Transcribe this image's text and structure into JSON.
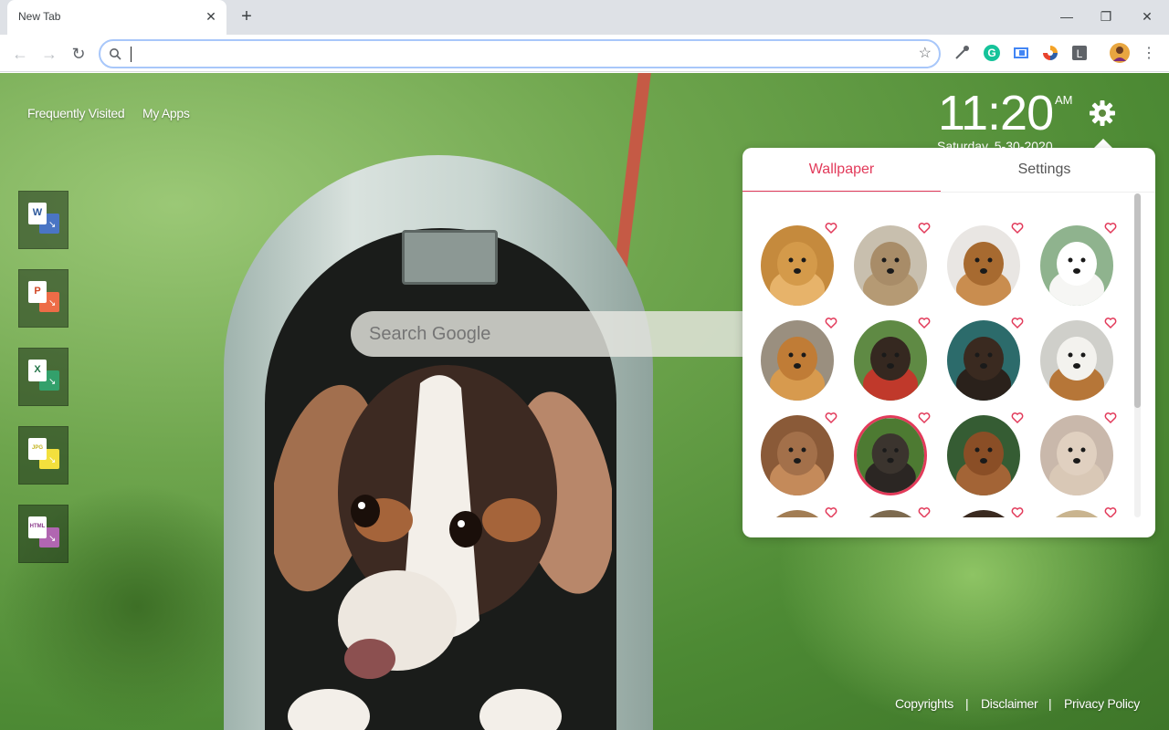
{
  "browser": {
    "tab_title": "New Tab",
    "tab_close": "✕",
    "new_tab": "+",
    "window_minimize": "—",
    "window_maximize": "❐",
    "window_close": "✕",
    "omnibox_value": "",
    "extensions": [
      "eyedropper-extension",
      "grammarly-extension",
      "tab-extension",
      "sync-extension",
      "l-extension",
      "profile-avatar"
    ]
  },
  "nav": {
    "frequently_visited": "Frequently Visited",
    "my_apps": "My Apps"
  },
  "apps": [
    {
      "name": "word",
      "letter": "W",
      "front": "#2b579a",
      "back": "#4a75c4"
    },
    {
      "name": "powerpoint",
      "letter": "P",
      "front": "#d24726",
      "back": "#ed6c47"
    },
    {
      "name": "excel",
      "letter": "X",
      "front": "#217346",
      "back": "#33a06b"
    },
    {
      "name": "jpg",
      "letter": "JPG",
      "front": "#c3b31e",
      "back": "#f3e03d"
    },
    {
      "name": "html",
      "letter": "HTML",
      "front": "#8c3c8c",
      "back": "#b166b1"
    }
  ],
  "search": {
    "placeholder": "Search Google"
  },
  "clock": {
    "time": "11:20",
    "ampm": "AM",
    "date": "Saturday, 5-30-2020"
  },
  "panel": {
    "tab_wallpaper": "Wallpaper",
    "tab_settings": "Settings",
    "selected_index": 9,
    "thumbs": [
      {
        "bg": "#c58a3d",
        "fg": "#e7b36a",
        "dog": "#d49a4a"
      },
      {
        "bg": "#c8bfae",
        "fg": "#b59a74",
        "dog": "#a88c68"
      },
      {
        "bg": "#e9e6e3",
        "fg": "#c98d4f",
        "dog": "#a76a30"
      },
      {
        "bg": "#8fb38e",
        "fg": "#f6f6f4",
        "dog": "#ffffff"
      },
      {
        "bg": "#9a8f7f",
        "fg": "#d79a4e",
        "dog": "#c07c36"
      },
      {
        "bg": "#5f8a44",
        "fg": "#c0392b",
        "dog": "#352820"
      },
      {
        "bg": "#2c6b6b",
        "fg": "#2a211b",
        "dog": "#3a2a20"
      },
      {
        "bg": "#cfcfca",
        "fg": "#b67638",
        "dog": "#f3f2ee"
      },
      {
        "bg": "#8a5a38",
        "fg": "#c48a5a",
        "dog": "#a3704a"
      },
      {
        "bg": "#4d7a32",
        "fg": "#2b2623",
        "dog": "#3b342e"
      },
      {
        "bg": "#355c33",
        "fg": "#a36436",
        "dog": "#8a4e26"
      },
      {
        "bg": "#c9b8ab",
        "fg": "#d9c8b6",
        "dog": "#e0d0c0"
      },
      {
        "bg": "#a27d54",
        "fg": "#c9a172",
        "dog": "#b08a60"
      },
      {
        "bg": "#7d6a4f",
        "fg": "#c9a26c",
        "dog": "#b68e58"
      },
      {
        "bg": "#3a2a20",
        "fg": "#7a4a2a",
        "dog": "#5a3520"
      },
      {
        "bg": "#c9b48f",
        "fg": "#e6d2b0",
        "dog": "#dcc49e"
      }
    ]
  },
  "footer": {
    "copyrights": "Copyrights",
    "disclaimer": "Disclaimer",
    "privacy": "Privacy Policy",
    "separator": "|"
  },
  "colors": {
    "accent": "#e23a5a"
  }
}
